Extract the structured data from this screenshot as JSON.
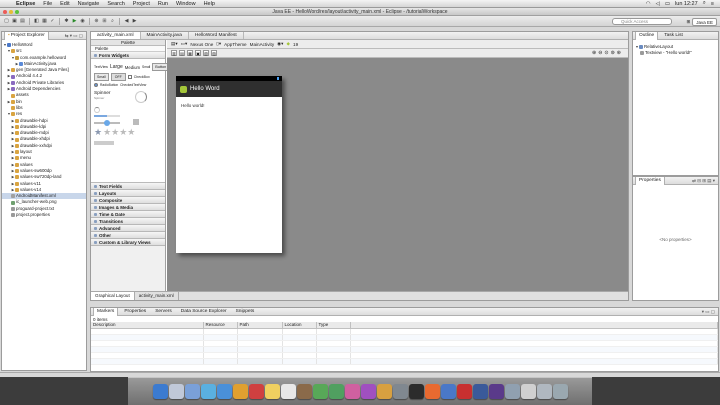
{
  "menubar": {
    "items": [
      "Eclipse",
      "File",
      "Edit",
      "Navigate",
      "Search",
      "Project",
      "Run",
      "Window",
      "Help"
    ],
    "clock": "lun 12:27"
  },
  "window": {
    "title": "Java EE - HelloWord/res/layout/activity_main.xml - Eclipse - /tutorialWorkspace"
  },
  "toolbar": {
    "quick_access_placeholder": "Quick Access",
    "perspective_label": "Java EE"
  },
  "explorer": {
    "title": "Project Explorer",
    "nodes": [
      {
        "label": "HelloWord",
        "depth": 0,
        "arrow": "▼",
        "icon": "project-icon"
      },
      {
        "label": "src",
        "depth": 1,
        "arrow": "▼",
        "icon": "folder-icon"
      },
      {
        "label": "com.example.helloword",
        "depth": 2,
        "arrow": "▼",
        "icon": "package-icon"
      },
      {
        "label": "MainActivity.java",
        "depth": 3,
        "arrow": "▶",
        "icon": "java-file-icon"
      },
      {
        "label": "gen [Generated Java Files]",
        "depth": 1,
        "arrow": "▶",
        "icon": "folder-icon"
      },
      {
        "label": "Android 4.4.2",
        "depth": 1,
        "arrow": "▶",
        "icon": "library-icon"
      },
      {
        "label": "Android Private Libraries",
        "depth": 1,
        "arrow": "▶",
        "icon": "library-icon"
      },
      {
        "label": "Android Dependencies",
        "depth": 1,
        "arrow": "▶",
        "icon": "library-icon"
      },
      {
        "label": "assets",
        "depth": 1,
        "arrow": "",
        "icon": "folder-icon"
      },
      {
        "label": "bin",
        "depth": 1,
        "arrow": "▶",
        "icon": "folder-icon"
      },
      {
        "label": "libs",
        "depth": 1,
        "arrow": "",
        "icon": "folder-icon"
      },
      {
        "label": "res",
        "depth": 1,
        "arrow": "▼",
        "icon": "folder-icon"
      },
      {
        "label": "drawable-hdpi",
        "depth": 2,
        "arrow": "▶",
        "icon": "folder-icon"
      },
      {
        "label": "drawable-ldpi",
        "depth": 2,
        "arrow": "▶",
        "icon": "folder-icon"
      },
      {
        "label": "drawable-mdpi",
        "depth": 2,
        "arrow": "▶",
        "icon": "folder-icon"
      },
      {
        "label": "drawable-xhdpi",
        "depth": 2,
        "arrow": "▶",
        "icon": "folder-icon"
      },
      {
        "label": "drawable-xxhdpi",
        "depth": 2,
        "arrow": "▶",
        "icon": "folder-icon"
      },
      {
        "label": "layout",
        "depth": 2,
        "arrow": "▶",
        "icon": "folder-icon"
      },
      {
        "label": "menu",
        "depth": 2,
        "arrow": "▶",
        "icon": "folder-icon"
      },
      {
        "label": "values",
        "depth": 2,
        "arrow": "▶",
        "icon": "folder-icon"
      },
      {
        "label": "values-sw600dp",
        "depth": 2,
        "arrow": "▶",
        "icon": "folder-icon"
      },
      {
        "label": "values-sw720dp-land",
        "depth": 2,
        "arrow": "▶",
        "icon": "folder-icon"
      },
      {
        "label": "values-v11",
        "depth": 2,
        "arrow": "▶",
        "icon": "folder-icon"
      },
      {
        "label": "values-v14",
        "depth": 2,
        "arrow": "▶",
        "icon": "folder-icon"
      },
      {
        "label": "AndroidManifest.xml",
        "depth": 1,
        "arrow": "",
        "icon": "xml-file-icon",
        "selected": true
      },
      {
        "label": "ic_launcher-web.png",
        "depth": 1,
        "arrow": "",
        "icon": "image-file-icon"
      },
      {
        "label": "proguard-project.txt",
        "depth": 1,
        "arrow": "",
        "icon": "text-file-icon"
      },
      {
        "label": "project.properties",
        "depth": 1,
        "arrow": "",
        "icon": "text-file-icon"
      }
    ]
  },
  "editor": {
    "tabs": [
      "activity_main.xml",
      "MainActivity.java",
      "HelloWord Manifest"
    ],
    "palette": {
      "title": "Palette",
      "search": "Palette",
      "open_category": "Form Widgets",
      "widgets": {
        "textview_row": [
          "TextView",
          "Large",
          "Medium",
          "Small",
          "Button"
        ],
        "small_row": [
          "Small",
          "OFF",
          "CheckBox"
        ],
        "radio": "RadioButton",
        "checked": "CheckedTextView",
        "spinner": "Spinner",
        "spinner_sub": "Spinner"
      },
      "categories": [
        "Text Fields",
        "Layouts",
        "Composite",
        "Images & Media",
        "Time & Date",
        "Transitions",
        "Advanced",
        "Other",
        "Custom & Library Views"
      ]
    },
    "canvas_toolbar": {
      "device": "Nexus One",
      "theme": "AppTheme",
      "activity": "MainActivity",
      "api": "19"
    },
    "device_preview": {
      "app_title": "Hello Word",
      "text": "Hello world!"
    },
    "bottom_tabs": [
      "Graphical Layout",
      "activity_main.xml"
    ]
  },
  "outline": {
    "tabs": [
      "Outline",
      "Task List"
    ],
    "nodes": [
      {
        "label": "RelativeLayout"
      },
      {
        "label": "Textview - \"Hello world!\""
      }
    ]
  },
  "properties": {
    "title": "Properties",
    "empty": "<No properties>"
  },
  "markers": {
    "tabs": [
      "Markers",
      "Properties",
      "Servers",
      "Data Source Explorer",
      "Snippets"
    ],
    "count": "0 items",
    "columns": [
      "Description",
      "Resource",
      "Path",
      "Location",
      "Type"
    ]
  },
  "colors": {
    "accent_android": "#a4c639",
    "selection": "#c8d6ea",
    "canvas": "#8a8a8a",
    "action_bar": "#2f2f2f"
  }
}
